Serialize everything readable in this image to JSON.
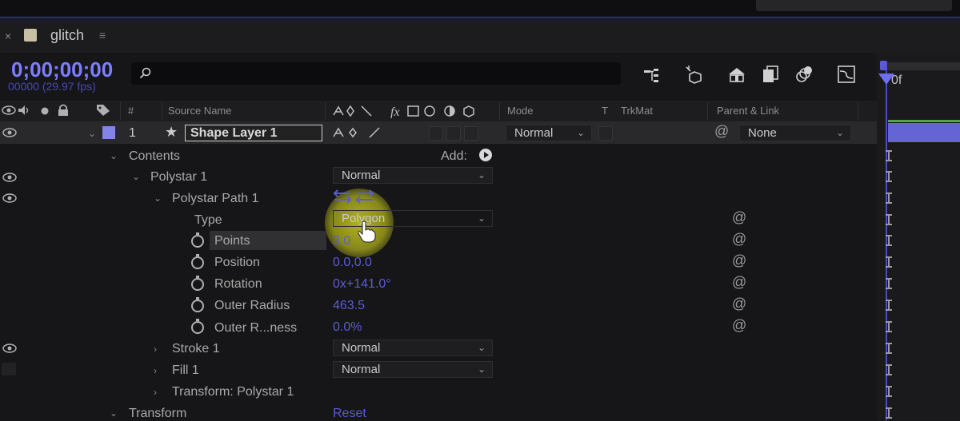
{
  "panel": {
    "close_glyph": "×",
    "tab_name": "glitch",
    "menu_glyph": "≡"
  },
  "timecode": {
    "value": "0;00;00;00",
    "frames": "00000 (29.97 fps)",
    "frame_marker": "0f"
  },
  "search": {
    "placeholder": ""
  },
  "columns": {
    "num": "#",
    "source_name": "Source Name",
    "mode": "Mode",
    "t": "T",
    "trkmat": "TrkMat",
    "parent_link": "Parent & Link"
  },
  "layer": {
    "number": "1",
    "star": "★",
    "name": "Shape Layer 1",
    "mode": "Normal",
    "parent": "None"
  },
  "properties": {
    "contents": "Contents",
    "add_label": "Add:",
    "polystar": "Polystar 1",
    "polystar_mode": "Normal",
    "polystar_path": "Polystar Path 1",
    "type_label": "Type",
    "type_value": "Polygon",
    "points_label": "Points",
    "points_value": "3.0",
    "position_label": "Position",
    "position_value": "0.0,0.0",
    "rotation_label": "Rotation",
    "rotation_value": "0x+141.0°",
    "outer_radius_label": "Outer Radius",
    "outer_radius_value": "463.5",
    "outer_roundness_label": "Outer R...ness",
    "outer_roundness_value": "0.0%",
    "stroke": "Stroke 1",
    "stroke_mode": "Normal",
    "fill": "Fill 1",
    "fill_mode": "Normal",
    "transform_polystar": "Transform: Polystar 1",
    "transform": "Transform",
    "reset": "Reset"
  },
  "colors": {
    "accent_blue": "#7d7dff",
    "label_purple": "#8484e6",
    "value_blue": "#5b5bd6",
    "cursor_highlight": "#e0e028"
  }
}
